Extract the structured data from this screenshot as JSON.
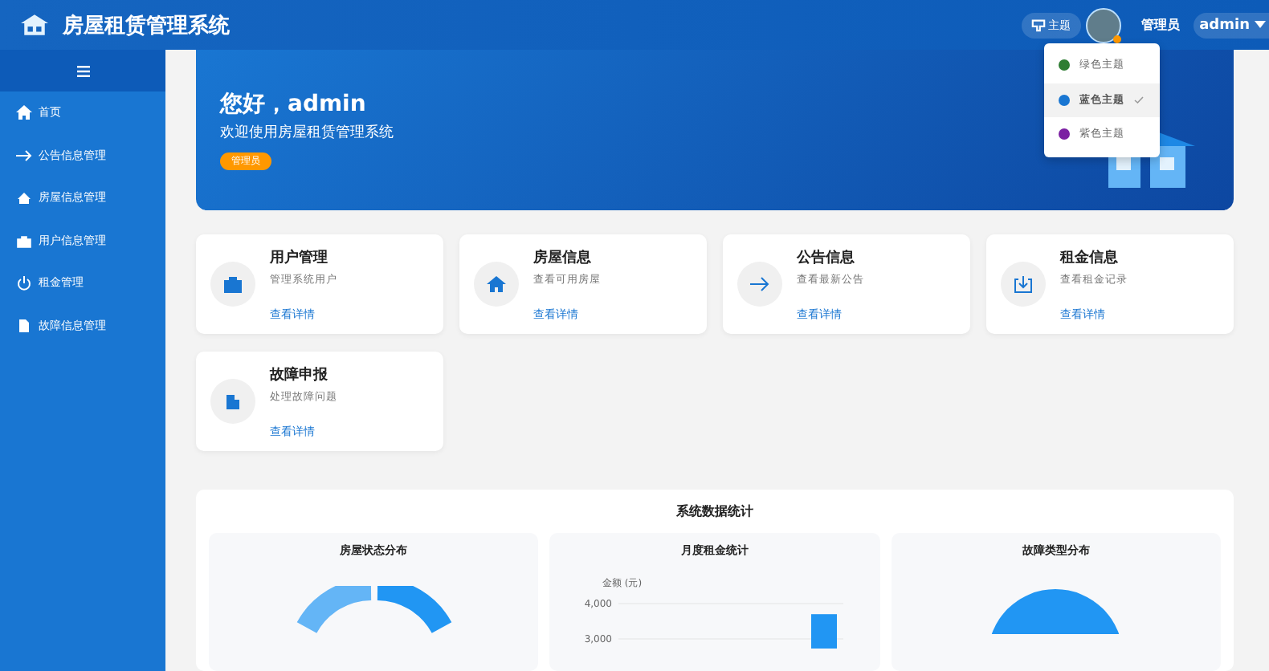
{
  "header": {
    "title": "房屋租赁管理系统",
    "theme_button": "主题",
    "role": "管理员",
    "user": "admin"
  },
  "theme_menu": [
    {
      "label": "绿色主题",
      "color": "#2e7d32",
      "selected": false
    },
    {
      "label": "蓝色主题",
      "color": "#1976d2",
      "selected": true
    },
    {
      "label": "紫色主题",
      "color": "#7b1fa2",
      "selected": false
    }
  ],
  "sidebar": {
    "items": [
      {
        "label": "首页"
      },
      {
        "label": "公告信息管理"
      },
      {
        "label": "房屋信息管理"
      },
      {
        "label": "用户信息管理"
      },
      {
        "label": "租金管理"
      },
      {
        "label": "故障信息管理"
      }
    ]
  },
  "banner": {
    "greeting": "您好，admin",
    "subtitle": "欢迎使用房屋租赁管理系统",
    "badge": "管理员"
  },
  "cards": [
    {
      "title": "用户管理",
      "desc": "管理系统用户",
      "link": "查看详情"
    },
    {
      "title": "房屋信息",
      "desc": "查看可用房屋",
      "link": "查看详情"
    },
    {
      "title": "公告信息",
      "desc": "查看最新公告",
      "link": "查看详情"
    },
    {
      "title": "租金信息",
      "desc": "查看租金记录",
      "link": "查看详情"
    },
    {
      "title": "故障申报",
      "desc": "处理故障问题",
      "link": "查看详情"
    }
  ],
  "stats": {
    "title": "系统数据统计",
    "panels": [
      {
        "kind": "donut",
        "title": "房屋状态分布"
      },
      {
        "kind": "bar",
        "title": "月度租金统计",
        "chart_data": {
          "type": "bar",
          "ylabel": "金额 (元)",
          "values": [
            3700
          ],
          "ylim": [
            0,
            4000
          ],
          "yticks": [
            {
              "value": 4000,
              "label": "4,000"
            },
            {
              "value": 3000,
              "label": "3,000"
            }
          ]
        }
      },
      {
        "kind": "pie",
        "title": "故障类型分布"
      }
    ]
  }
}
